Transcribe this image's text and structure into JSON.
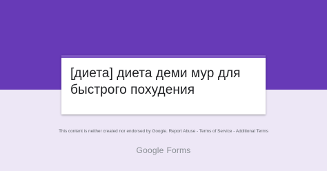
{
  "header": {
    "banner_color": "#673ab7",
    "accent_color": "#7e57c2"
  },
  "form": {
    "title": "[диета] диета деми мур для быстрого похудения"
  },
  "footer": {
    "disclaimer_text": "This content is neither created nor endorsed by Google.",
    "report_abuse_label": "Report Abuse",
    "sep1": " - ",
    "terms_of_service_label": "Terms of Service",
    "sep2": " - ",
    "additional_terms_label": "Additional Terms",
    "logo_brand": "Google",
    "logo_product": "Forms"
  }
}
